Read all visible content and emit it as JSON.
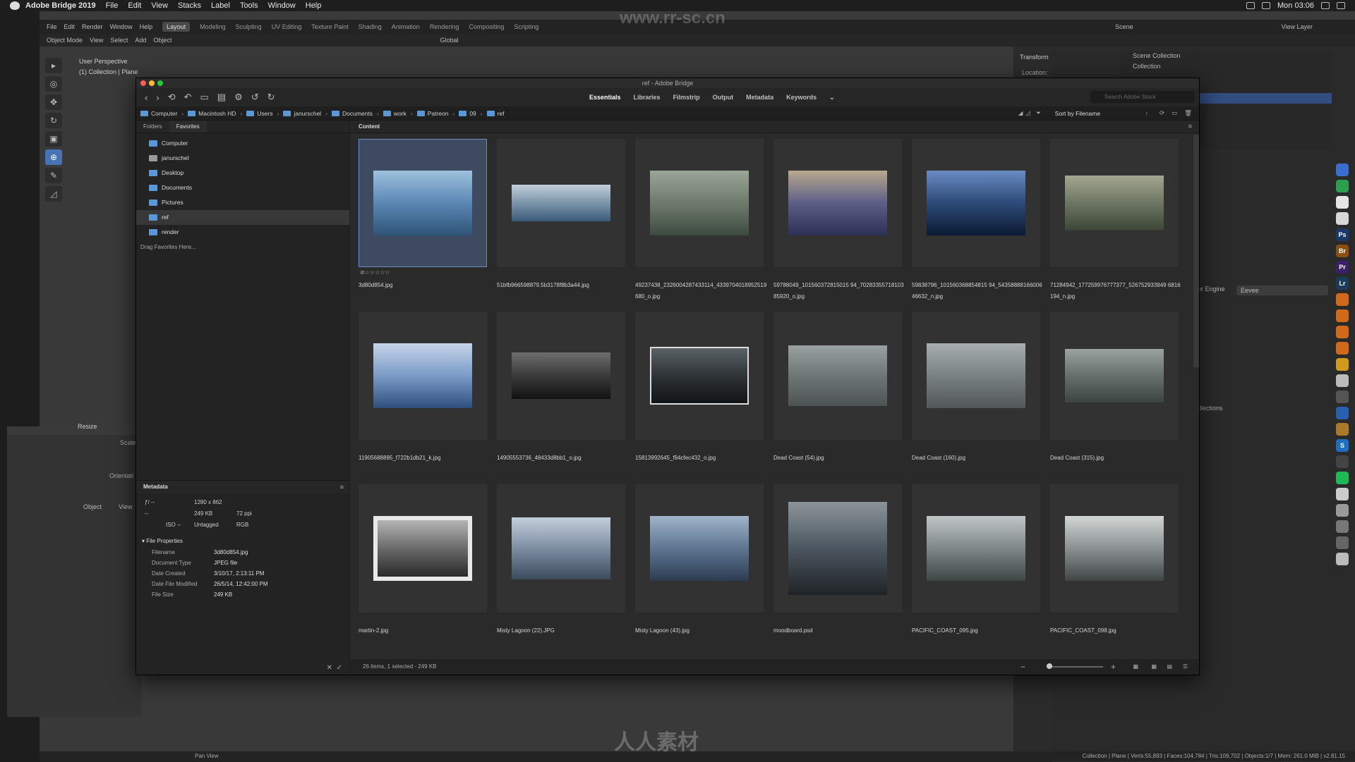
{
  "menubar": {
    "app": "Adobe Bridge 2019",
    "items": [
      "File",
      "Edit",
      "View",
      "Stacks",
      "Label",
      "Tools",
      "Window",
      "Help"
    ],
    "clock": "Mon 03:06"
  },
  "blender": {
    "menus": [
      "File",
      "Edit",
      "Render",
      "Window",
      "Help"
    ],
    "workspaces": [
      "Layout",
      "Modeling",
      "Sculpting",
      "UV Editing",
      "Texture Paint",
      "Shading",
      "Animation",
      "Rendering",
      "Compositing",
      "Scripting"
    ],
    "active_workspace": "Layout",
    "header": [
      "Object Mode",
      "View",
      "Select",
      "Add",
      "Object"
    ],
    "orientation": "Global",
    "scene": "Scene",
    "view_layer": "View Layer",
    "viewport_line1": "User Perspective",
    "viewport_line2": "(1) Collection | Plane",
    "transform_label": "Transform",
    "location_label": "Location:",
    "outliner_rows": [
      "Scene Collection",
      "Collection"
    ],
    "render_engine_label": "er Engine",
    "render_engine_value": "Eevee",
    "collections_label": "llections",
    "resize_label": "Resize",
    "scale_label": "Scale",
    "orient_label": "Orientati",
    "small_header": [
      "Object",
      "View"
    ],
    "status_left": "Pan View",
    "status_right": "Collection | Plane | Verts:55,893 | Faces:104,784 | Tris:109,702 | Objects:1/7 | Mem: 261.0 MiB | v2.81.15"
  },
  "bridge": {
    "title": "ref - Adobe Bridge",
    "workspaces": [
      "Essentials",
      "Libraries",
      "Filmstrip",
      "Output",
      "Metadata",
      "Keywords"
    ],
    "active_workspace": "Essentials",
    "search_placeholder": "Search Adobe Stock",
    "breadcrumb": [
      "Computer",
      "Macintosh HD",
      "Users",
      "janurschel",
      "Documents",
      "work",
      "Patreon",
      "09",
      "ref"
    ],
    "sort_label": "Sort by Filename",
    "left_tabs": [
      "Folders",
      "Favorites"
    ],
    "favorites": [
      "Computer",
      "janurschel",
      "Desktop",
      "Documents",
      "Pictures",
      "ref",
      "render"
    ],
    "favorites_hint": "Drag Favorites Here...",
    "content_tab": "Content",
    "metadata_title": "Metadata",
    "meta_summary": {
      "fstop": "ƒ/ --",
      "shutter": "--",
      "dimensions": "1280 x 862",
      "size": "249 KB",
      "ppi": "72 ppi",
      "iso": "ISO --",
      "tagged": "Untagged",
      "color": "RGB"
    },
    "file_properties_title": "File Properties",
    "file_properties": [
      {
        "k": "Filename",
        "v": "3d80d854.jpg"
      },
      {
        "k": "Document Type",
        "v": "JPEG file"
      },
      {
        "k": "Date Created",
        "v": "3/10/17, 2:13:11 PM"
      },
      {
        "k": "Date File Modified",
        "v": "26/5/14, 12:42:00 PM"
      },
      {
        "k": "File Size",
        "v": "249 KB"
      }
    ],
    "items": [
      {
        "name": "3d80d854.jpg",
        "colors": [
          "#2e5477",
          "#5b87b4",
          "#9ec2de"
        ],
        "w": 140,
        "h": 92
      },
      {
        "name": "51bfb966598879.5b3178f8b3a44.jpg",
        "colors": [
          "#3a5a78",
          "#7b94a9",
          "#c2cfda"
        ],
        "w": 140,
        "h": 52
      },
      {
        "name": "49237438_2326004287433114_4339704018952519680_o.jpg",
        "colors": [
          "#3d4a40",
          "#6e7b6c",
          "#9aa597"
        ],
        "w": 140,
        "h": 92
      },
      {
        "name": "59788049_101560372815015 94_7028335571810385920_o.jpg",
        "colors": [
          "#2d2f55",
          "#5c5e86",
          "#b8a990"
        ],
        "w": 140,
        "h": 92
      },
      {
        "name": "59838796_101560368854815 94_5435888816600646632_n.jpg",
        "colors": [
          "#0c1a33",
          "#2c4a78",
          "#6a8cc4"
        ],
        "w": 140,
        "h": 92
      },
      {
        "name": "71284942_177259976777377_526752933949 6816194_n.jpg",
        "colors": [
          "#3d4636",
          "#6d7663",
          "#a3a690"
        ],
        "w": 140,
        "h": 78
      },
      {
        "name": "11905688895_f722b1db21_k.jpg",
        "colors": [
          "#2e4f7d",
          "#7b9bc7",
          "#c5d4e8"
        ],
        "w": 140,
        "h": 92
      },
      {
        "name": "14905553736_48433d8bb1_o.jpg",
        "colors": [
          "#121212",
          "#3a3a3a",
          "#6e6e6e"
        ],
        "w": 140,
        "h": 66
      },
      {
        "name": "15813992645_f94cfec432_o.jpg",
        "colors": [
          "#121416",
          "#2e3336",
          "#5a6266"
        ],
        "w": 140,
        "h": 82
      },
      {
        "name": "Dead Coast (54).jpg",
        "colors": [
          "#4c5352",
          "#6f7776",
          "#9aa1a0"
        ],
        "w": 140,
        "h": 86
      },
      {
        "name": "Dead Coast (160).jpg",
        "colors": [
          "#515757",
          "#7a8181",
          "#a8aeae"
        ],
        "w": 140,
        "h": 92
      },
      {
        "name": "Dead Coast (315).jpg",
        "colors": [
          "#3c4441",
          "#66706c",
          "#9ba39f"
        ],
        "w": 140,
        "h": 76
      },
      {
        "name": "martin-2.jpg",
        "colors": [
          "#2a2a2a",
          "#6a6a6a",
          "#b5b5b5"
        ],
        "w": 140,
        "h": 92
      },
      {
        "name": "Misty Lagoon (22).JPG",
        "colors": [
          "#3c4a5c",
          "#7d8ea2",
          "#c3cedb"
        ],
        "w": 140,
        "h": 88
      },
      {
        "name": "Misty Lagoon (43).jpg",
        "colors": [
          "#2c3d52",
          "#5e7591",
          "#a1b4c9"
        ],
        "w": 140,
        "h": 92
      },
      {
        "name": "moodboard.psd",
        "colors": [
          "#1f2327",
          "#4c5660",
          "#8a9499"
        ],
        "w": 140,
        "h": 132
      },
      {
        "name": "PACIFIC_COAST_095.jpg",
        "colors": [
          "#3f4746",
          "#7e8786",
          "#c1c7c6"
        ],
        "w": 140,
        "h": 92
      },
      {
        "name": "PACIFIC_COAST_098.jpg",
        "colors": [
          "#404645",
          "#8a9190",
          "#d2d6d5"
        ],
        "w": 140,
        "h": 92
      }
    ],
    "status": "26 items, 1 selected - 249 KB",
    "zoom_level": 0.0
  },
  "watermark": "人人素材",
  "watermark_top": "www.rr-sc.cn",
  "accent": "#4772b3"
}
